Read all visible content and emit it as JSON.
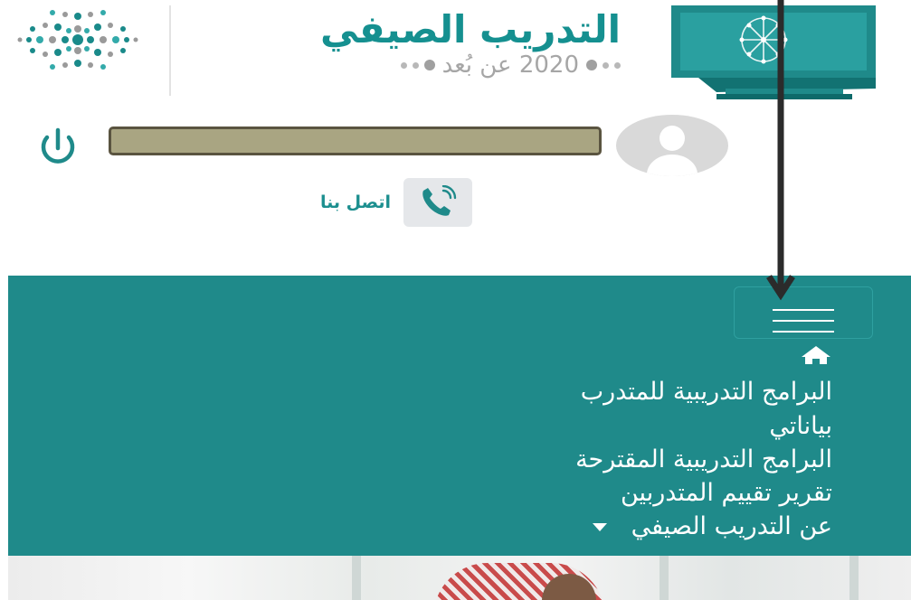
{
  "header": {
    "brand_title": "التدريب الصيفي",
    "brand_subtitle": "2020 عن بُعد"
  },
  "user": {
    "name_redacted": ""
  },
  "contact": {
    "label": "اتصل بنا"
  },
  "nav": {
    "items": [
      {
        "label": "البرامج التدريبية للمتدرب"
      },
      {
        "label": "بياناتي"
      },
      {
        "label": "البرامج التدريبية المقترحة"
      },
      {
        "label": "تقرير تقييم المتدربين"
      },
      {
        "label": "عن التدريب الصيفي"
      }
    ]
  },
  "icons": {
    "power": "power-icon",
    "phone": "phone-icon",
    "home": "home-icon",
    "menu": "hamburger-icon",
    "dropdown": "caret-down-icon"
  },
  "colors": {
    "brand_teal": "#1f8a8a",
    "title_teal": "#159090",
    "redaction": "#a9a582",
    "annotation": "#2b2b2b"
  }
}
